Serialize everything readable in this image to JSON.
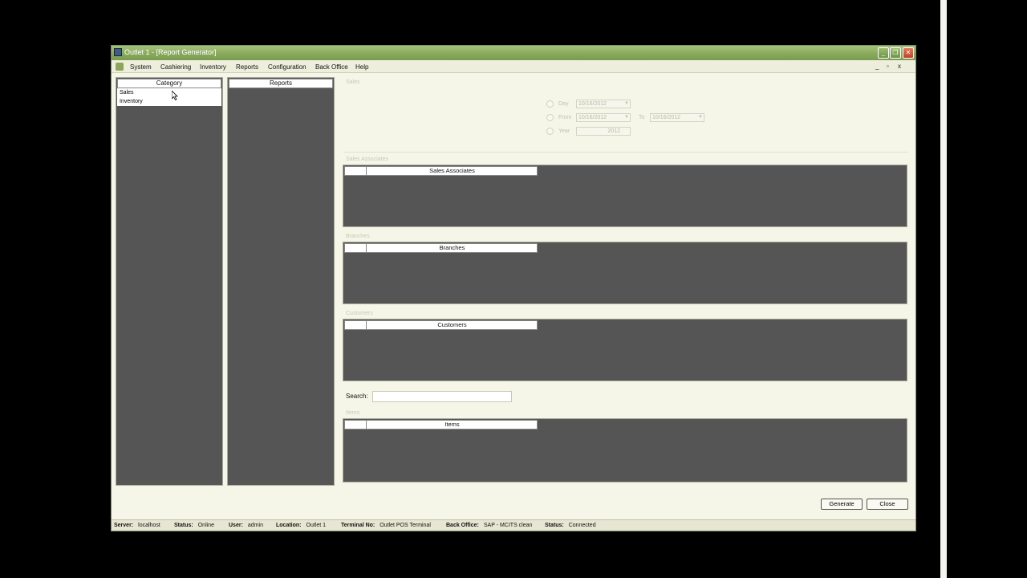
{
  "window": {
    "title": "Outlet 1 - [Report Generator]"
  },
  "titlebar_buttons": {
    "minimize": "_",
    "restore": "❐",
    "close": "✕"
  },
  "menu": {
    "items": [
      "System",
      "Cashiering",
      "Inventory",
      "Reports",
      "Configuration",
      "Back Office",
      "Help"
    ],
    "mdi": {
      "minimize": "_",
      "restore": "▫",
      "close": "x"
    }
  },
  "category_panel": {
    "header": "Category",
    "items": [
      "Sales",
      "Inventory"
    ]
  },
  "reports_panel": {
    "header": "Reports"
  },
  "sales_group": {
    "label": "Sales",
    "day_label": "Day",
    "from_label": "From",
    "to_label": "To",
    "year_label": "Year",
    "day_value": "10/16/2012",
    "from_value": "10/16/2012",
    "to_value": "10/16/2012",
    "year_value": "2012"
  },
  "sales_associates_group": {
    "label": "Sales Associates",
    "grid_header": "Sales Associates"
  },
  "branches_group": {
    "label": "Branches",
    "grid_header": "Branches"
  },
  "customers_group": {
    "label": "Customers",
    "grid_header": "Customers"
  },
  "search": {
    "label": "Search:",
    "value": ""
  },
  "items_group": {
    "label": "Items",
    "grid_header": "Items"
  },
  "buttons": {
    "generate": "Generate",
    "close": "Close"
  },
  "status_bar": {
    "server_label": "Server:",
    "server_value": "localhost",
    "status_label": "Status:",
    "status_value": "Online",
    "user_label": "User:",
    "user_value": "admin",
    "location_label": "Location:",
    "location_value": "Outlet 1",
    "terminal_label": "Terminal No:",
    "terminal_value": "Outlet POS Terminal",
    "backoffice_label": "Back Office:",
    "backoffice_value": "SAP - MCITS clean",
    "conn_label": "Status:",
    "conn_value": "Connected"
  }
}
